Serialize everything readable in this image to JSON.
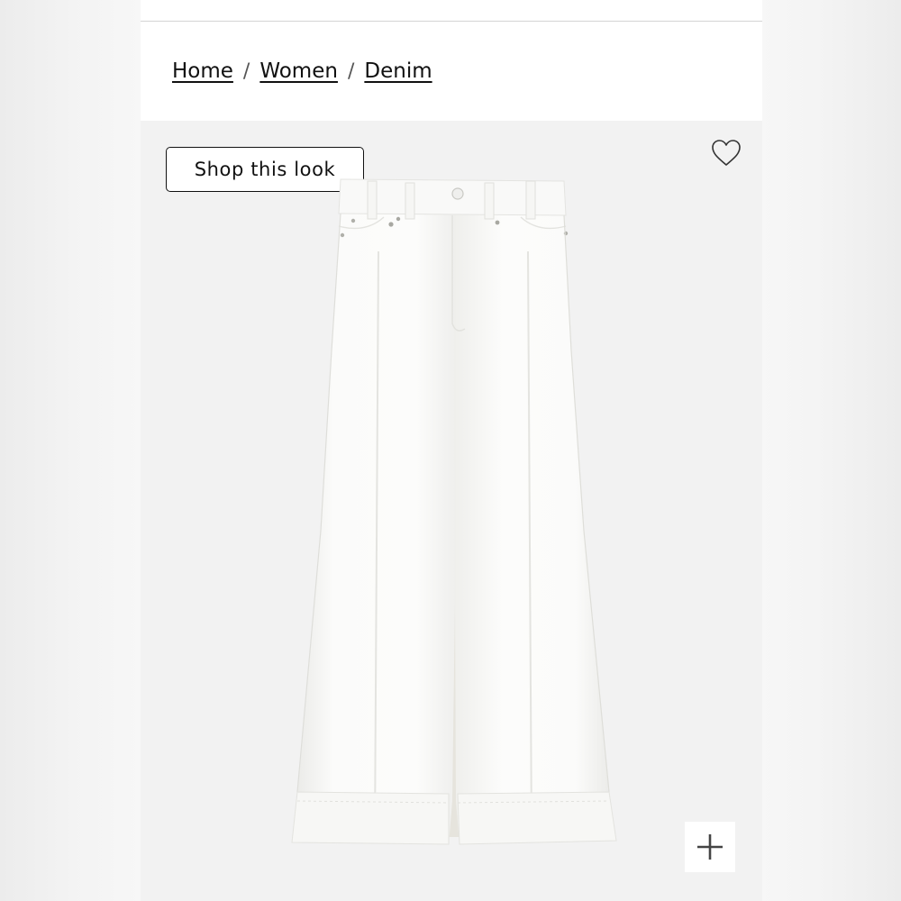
{
  "breadcrumb": {
    "items": [
      {
        "label": "Home"
      },
      {
        "label": "Women"
      },
      {
        "label": "Denim"
      }
    ],
    "separator": "/"
  },
  "product_gallery": {
    "shop_look_label": "Shop this look",
    "favorite_icon": "heart-outline-icon",
    "zoom_icon": "plus-icon",
    "image_subject": "white wide-leg jeans"
  },
  "colors": {
    "background": "#f2f2f2",
    "text": "#111111",
    "garment": "#fafafa"
  }
}
